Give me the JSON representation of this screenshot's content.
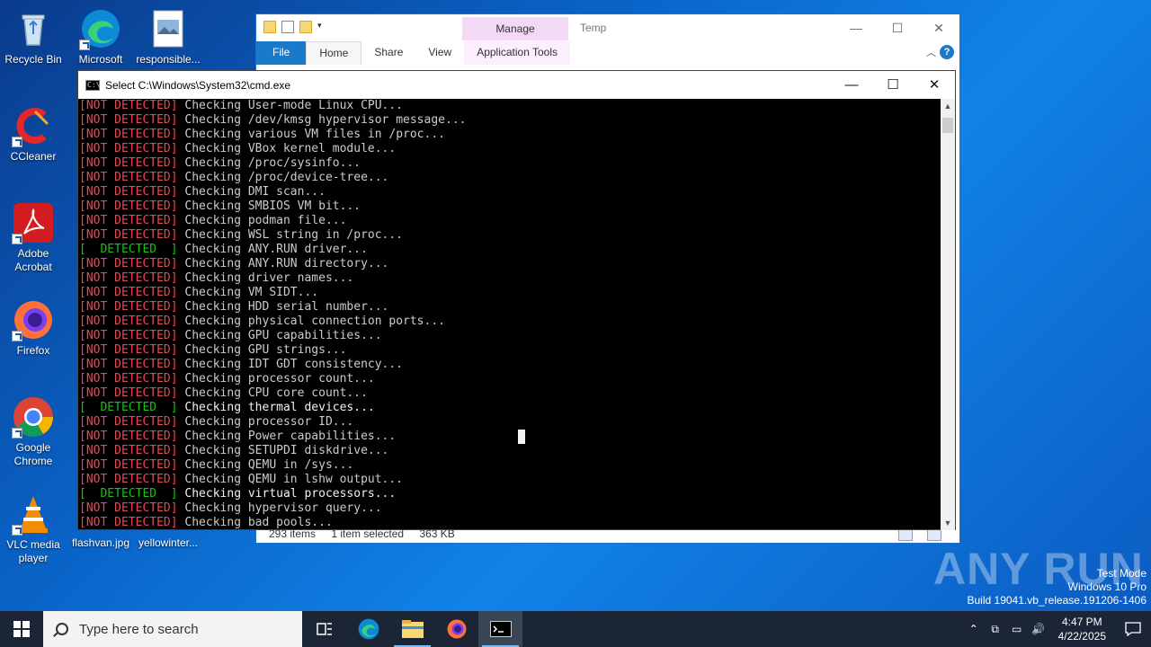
{
  "desktop": {
    "icons": [
      {
        "label": "Recycle Bin"
      },
      {
        "label": "Microsoft Edge"
      },
      {
        "label": "responsible..."
      },
      {
        "label": "CCleaner"
      },
      {
        "label": "Adobe Acrobat"
      },
      {
        "label": "Firefox"
      },
      {
        "label": "Google Chrome"
      },
      {
        "label": "VLC media player"
      },
      {
        "label": "flashvan.jpg"
      },
      {
        "label": "yellowinter..."
      }
    ]
  },
  "explorer": {
    "title": "Temp",
    "manage_tab": "Manage",
    "tabs": [
      "File",
      "Home",
      "Share",
      "View",
      "Application Tools"
    ],
    "status": {
      "items": "293 items",
      "selected": "1 item selected",
      "size": "363 KB"
    }
  },
  "cmd": {
    "title": "Select C:\\Windows\\System32\\cmd.exe",
    "lines": [
      {
        "status": "[NOT DETECTED]",
        "text": "Checking User-mode Linux CPU...",
        "detected": false
      },
      {
        "status": "[NOT DETECTED]",
        "text": "Checking /dev/kmsg hypervisor message...",
        "detected": false
      },
      {
        "status": "[NOT DETECTED]",
        "text": "Checking various VM files in /proc...",
        "detected": false
      },
      {
        "status": "[NOT DETECTED]",
        "text": "Checking VBox kernel module...",
        "detected": false
      },
      {
        "status": "[NOT DETECTED]",
        "text": "Checking /proc/sysinfo...",
        "detected": false
      },
      {
        "status": "[NOT DETECTED]",
        "text": "Checking /proc/device-tree...",
        "detected": false
      },
      {
        "status": "[NOT DETECTED]",
        "text": "Checking DMI scan...",
        "detected": false
      },
      {
        "status": "[NOT DETECTED]",
        "text": "Checking SMBIOS VM bit...",
        "detected": false
      },
      {
        "status": "[NOT DETECTED]",
        "text": "Checking podman file...",
        "detected": false
      },
      {
        "status": "[NOT DETECTED]",
        "text": "Checking WSL string in /proc...",
        "detected": false
      },
      {
        "status": "[  DETECTED  ]",
        "text": "Checking ANY.RUN driver...",
        "detected": true,
        "bright": false
      },
      {
        "status": "[NOT DETECTED]",
        "text": "Checking ANY.RUN directory...",
        "detected": false
      },
      {
        "status": "[NOT DETECTED]",
        "text": "Checking driver names...",
        "detected": false
      },
      {
        "status": "[NOT DETECTED]",
        "text": "Checking VM SIDT...",
        "detected": false
      },
      {
        "status": "[NOT DETECTED]",
        "text": "Checking HDD serial number...",
        "detected": false
      },
      {
        "status": "[NOT DETECTED]",
        "text": "Checking physical connection ports...",
        "detected": false
      },
      {
        "status": "[NOT DETECTED]",
        "text": "Checking GPU capabilities...",
        "detected": false
      },
      {
        "status": "[NOT DETECTED]",
        "text": "Checking GPU strings...",
        "detected": false
      },
      {
        "status": "[NOT DETECTED]",
        "text": "Checking IDT GDT consistency...",
        "detected": false
      },
      {
        "status": "[NOT DETECTED]",
        "text": "Checking processor count...",
        "detected": false
      },
      {
        "status": "[NOT DETECTED]",
        "text": "Checking CPU core count...",
        "detected": false
      },
      {
        "status": "[  DETECTED  ]",
        "text": "Checking thermal devices...",
        "detected": true,
        "bright": true
      },
      {
        "status": "[NOT DETECTED]",
        "text": "Checking processor ID...",
        "detected": false
      },
      {
        "status": "[NOT DETECTED]",
        "text": "Checking Power capabilities...",
        "detected": false
      },
      {
        "status": "[NOT DETECTED]",
        "text": "Checking SETUPDI diskdrive...",
        "detected": false
      },
      {
        "status": "[NOT DETECTED]",
        "text": "Checking QEMU in /sys...",
        "detected": false
      },
      {
        "status": "[NOT DETECTED]",
        "text": "Checking QEMU in lshw output...",
        "detected": false
      },
      {
        "status": "[  DETECTED  ]",
        "text": "Checking virtual processors...",
        "detected": true,
        "bright": true
      },
      {
        "status": "[NOT DETECTED]",
        "text": "Checking hypervisor query...",
        "detected": false
      },
      {
        "status": "[NOT DETECTED]",
        "text": "Checking bad pools...",
        "detected": false
      }
    ]
  },
  "watermark": {
    "brand": "ANY RUN",
    "mode": "Test Mode",
    "os": "Windows 10 Pro",
    "build": "Build 19041.vb_release.191206-1406"
  },
  "taskbar": {
    "search_placeholder": "Type here to search",
    "time": "4:47 PM",
    "date": "4/22/2025"
  },
  "colors": {
    "not_detected": "#e74856",
    "detected": "#16c60c",
    "taskbar": "#1b2536"
  }
}
